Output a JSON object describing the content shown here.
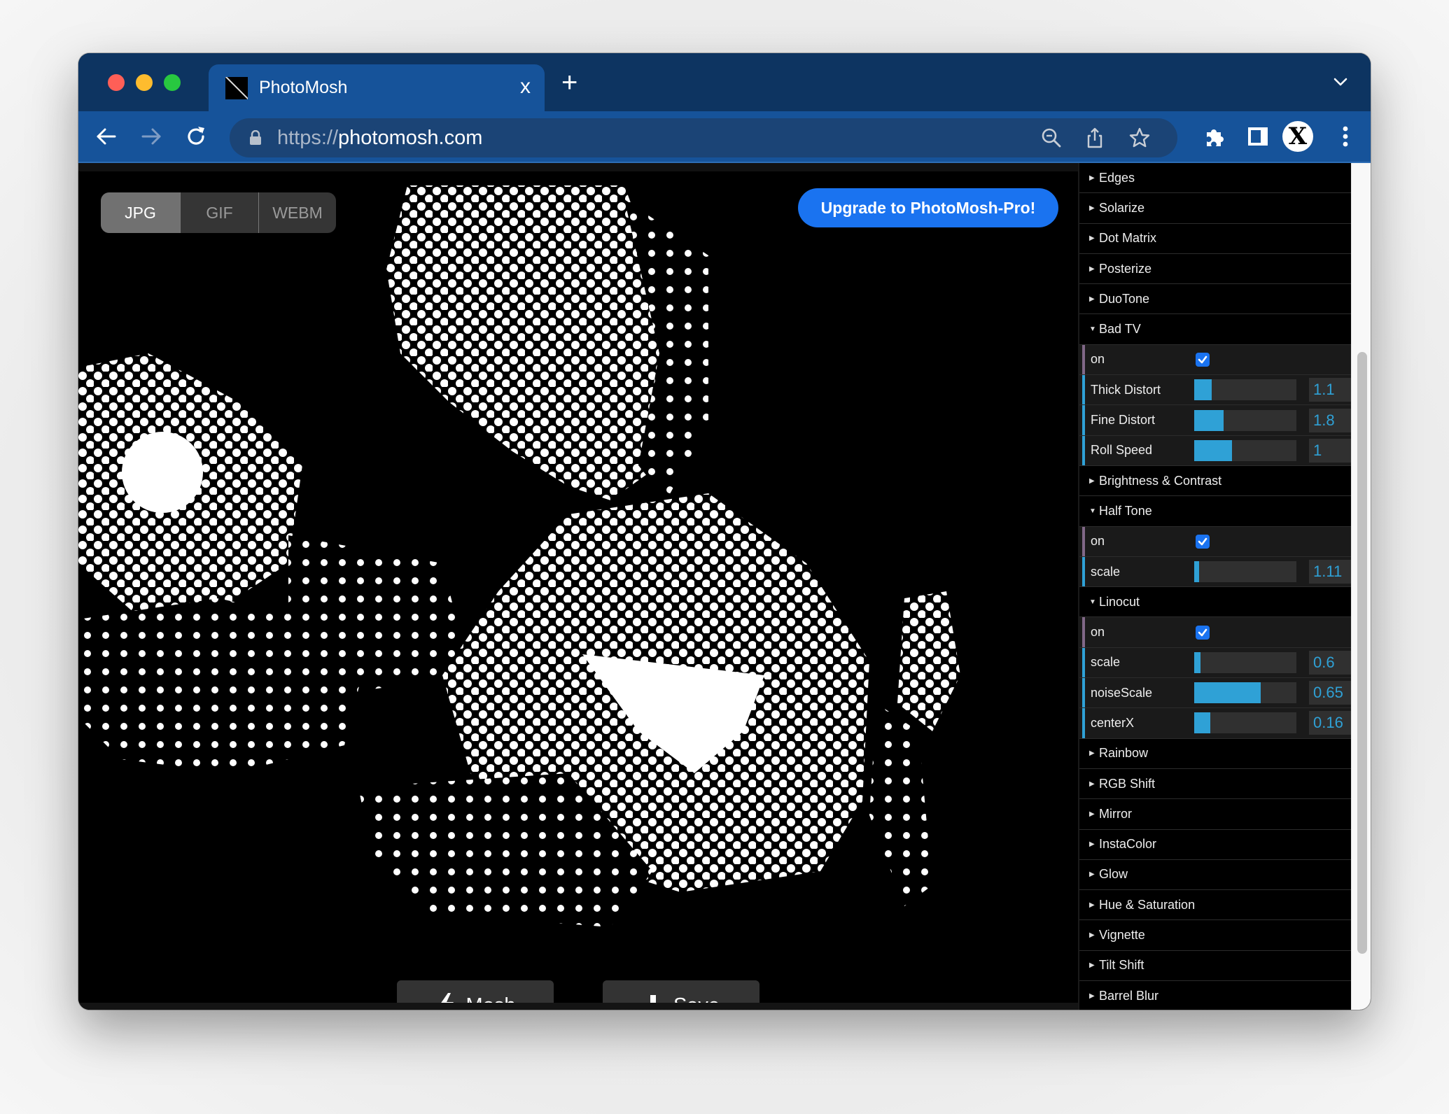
{
  "browser": {
    "tab_title": "PhotoMosh",
    "tab_close_label": "x",
    "new_tab_label": "+",
    "url_scheme": "https://",
    "url_host": "photomosh.com",
    "profile_initial": "X",
    "icons": {
      "back": "arrow-left-icon",
      "forward": "arrow-right-icon",
      "reload": "reload-icon",
      "lock": "lock-icon",
      "zoom": "zoom-out-icon",
      "share": "share-icon",
      "bookmark": "star-icon",
      "extensions": "puzzle-icon",
      "sidepanel": "side-panel-icon",
      "menu": "kebab-menu-icon",
      "tab_list": "chevron-down-icon"
    }
  },
  "app": {
    "formats": [
      {
        "label": "JPG",
        "active": true
      },
      {
        "label": "GIF",
        "active": false
      },
      {
        "label": "WEBM",
        "active": false
      }
    ],
    "upgrade_label": "Upgrade to PhotoMosh-Pro!",
    "mosh_label": "Mosh",
    "save_label": "Save",
    "accent_color": "#1a73f0",
    "slider_color": "#2fa1d6"
  },
  "effects": [
    {
      "name": "Edges",
      "open": false
    },
    {
      "name": "Solarize",
      "open": false
    },
    {
      "name": "Dot Matrix",
      "open": false
    },
    {
      "name": "Posterize",
      "open": false
    },
    {
      "name": "DuoTone",
      "open": false
    },
    {
      "name": "Bad TV",
      "open": true,
      "controls": [
        {
          "type": "bool",
          "label": "on",
          "checked": true
        },
        {
          "type": "num",
          "label": "Thick Distort",
          "value": "1.1",
          "fraction": 0.17
        },
        {
          "type": "num",
          "label": "Fine Distort",
          "value": "1.8",
          "fraction": 0.29
        },
        {
          "type": "num",
          "label": "Roll Speed",
          "value": "1",
          "fraction": 0.37
        }
      ]
    },
    {
      "name": "Brightness & Contrast",
      "open": false
    },
    {
      "name": "Half Tone",
      "open": true,
      "controls": [
        {
          "type": "bool",
          "label": "on",
          "checked": true
        },
        {
          "type": "num",
          "label": "scale",
          "value": "1.11",
          "fraction": 0.05
        }
      ]
    },
    {
      "name": "Linocut",
      "open": true,
      "controls": [
        {
          "type": "bool",
          "label": "on",
          "checked": true
        },
        {
          "type": "num",
          "label": "scale",
          "value": "0.6",
          "fraction": 0.06
        },
        {
          "type": "num",
          "label": "noiseScale",
          "value": "0.65",
          "fraction": 0.65
        },
        {
          "type": "num",
          "label": "centerX",
          "value": "0.16",
          "fraction": 0.16
        }
      ]
    },
    {
      "name": "Rainbow",
      "open": false
    },
    {
      "name": "RGB Shift",
      "open": false
    },
    {
      "name": "Mirror",
      "open": false
    },
    {
      "name": "InstaColor",
      "open": false
    },
    {
      "name": "Glow",
      "open": false
    },
    {
      "name": "Hue & Saturation",
      "open": false
    },
    {
      "name": "Vignette",
      "open": false
    },
    {
      "name": "Tilt Shift",
      "open": false
    },
    {
      "name": "Barrel Blur",
      "open": false
    }
  ]
}
